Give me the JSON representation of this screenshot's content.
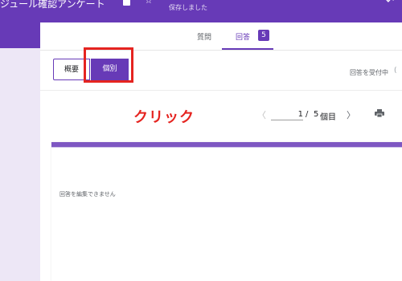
{
  "header": {
    "app_title": "ジュール確認アンケート",
    "saved_status": "保存しました"
  },
  "tabs": {
    "questions_label": "質問",
    "responses_label": "回答",
    "responses_count": "5"
  },
  "view_toggle": {
    "summary_label": "概要",
    "individual_label": "個別"
  },
  "accepting_label": "回答を受付中",
  "annotation": {
    "click_label": "クリック"
  },
  "pagination": {
    "current": "1",
    "separator": "/",
    "total": "5",
    "unit": "個目"
  },
  "form": {
    "no_edit_notice": "回答を編集できません"
  },
  "colors": {
    "brand": "#673ab7",
    "highlight": "#e52420"
  },
  "icons": [
    "folder-icon",
    "star-icon",
    "undo-icon",
    "chevron-left-icon",
    "chevron-right-icon",
    "print-icon"
  ]
}
